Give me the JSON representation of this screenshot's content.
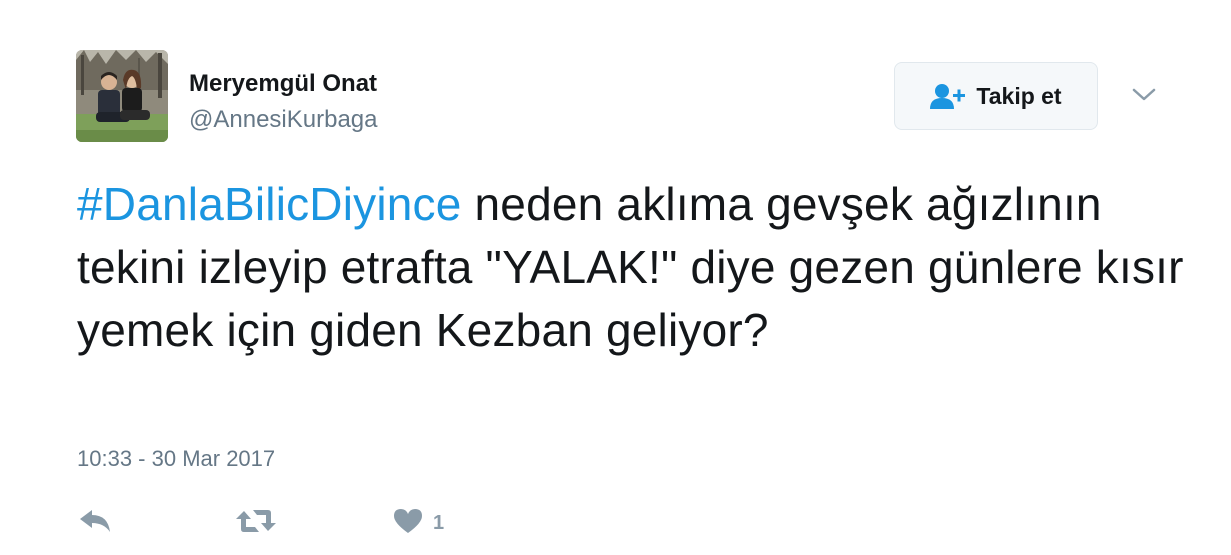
{
  "user": {
    "name": "Meryemgül Onat",
    "handle": "@AnnesiKurbaga",
    "avatar_icon": "profile-photo"
  },
  "follow_button": {
    "label": "Takip et",
    "icon": "follow-person-plus-icon"
  },
  "menu": {
    "icon": "chevron-down-icon"
  },
  "tweet": {
    "hashtag": "#DanlaBilicDiyince",
    "text": " neden aklıma gevşek ağızlının tekini izleyip etrafta \"YALAK!\" diye gezen günlere kısır yemek için giden Kezban geliyor?",
    "timestamp": "10:33 - 30 Mar 2017"
  },
  "actions": {
    "reply_icon": "reply-icon",
    "retweet_icon": "retweet-icon",
    "like_icon": "heart-icon",
    "like_count": "1"
  },
  "colors": {
    "text": "#14171a",
    "secondary": "#657786",
    "link": "#1b95e0",
    "icon": "#8a9ba8",
    "button_bg": "#f5f8fa",
    "button_border": "#e1e8ed"
  }
}
